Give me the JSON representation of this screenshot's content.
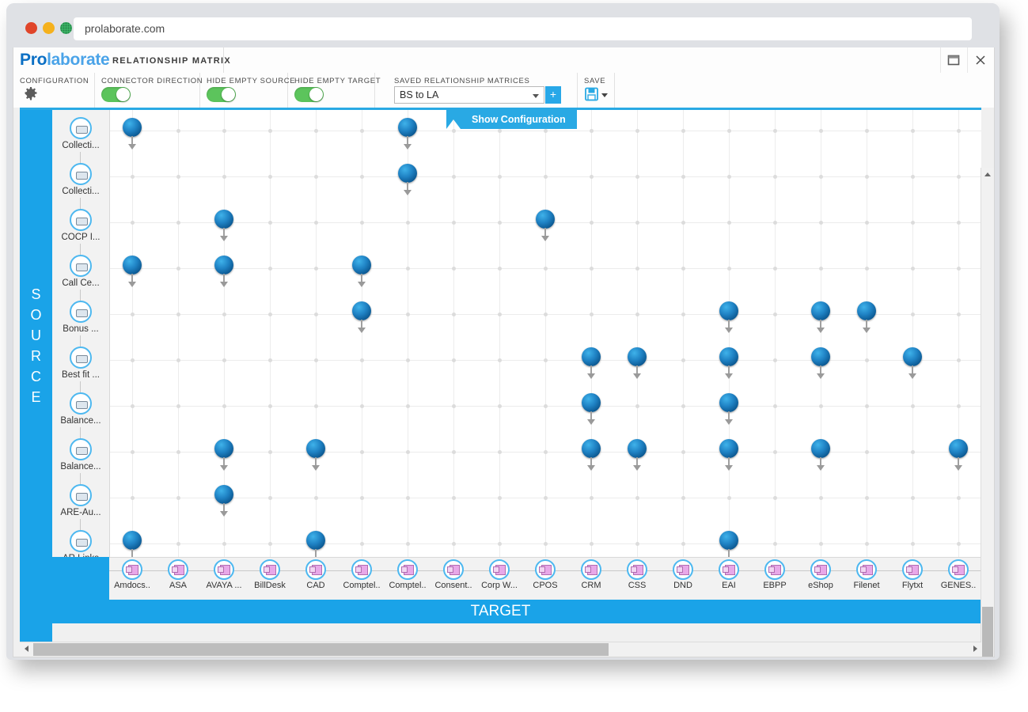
{
  "browser": {
    "url": "prolaborate.com",
    "traffic_lights": [
      "close",
      "minimize",
      "maximize"
    ]
  },
  "app": {
    "brand_pro": "Pro",
    "brand_laborate": "laborate",
    "subtitle": "RELATIONSHIP MATRIX",
    "window_buttons": {
      "restore": "restore-icon",
      "close": "close-icon"
    }
  },
  "toolbar": {
    "configuration_label": "CONFIGURATION",
    "configuration_icon": "gear-icon",
    "connector_direction_label": "CONNECTOR DIRECTION",
    "connector_direction_on": true,
    "hide_empty_source_label": "HIDE EMPTY SOURCE",
    "hide_empty_source_on": true,
    "hide_empty_target_label": "HIDE EMPTY TARGET",
    "hide_empty_target_on": true,
    "saved_matrices_label": "SAVED RELATIONSHIP MATRICES",
    "saved_matrices_value": "BS to LA",
    "add_button_label": "+",
    "save_label": "SAVE",
    "save_icon": "floppy-disk-icon"
  },
  "matrix": {
    "show_configuration_label": "Show Configuration",
    "source_axis_label": "SOURCE",
    "target_axis_label": "TARGET",
    "accent_color": "#1aa3e8",
    "marker_color": "#1f82c4",
    "toggle_color": "#5cc45c"
  },
  "chart_data": {
    "type": "heatmap",
    "title": "Relationship Matrix — BS to LA",
    "xlabel": "TARGET",
    "ylabel": "SOURCE",
    "grid": true,
    "legend": "none",
    "categories": [
      "Amdocs..",
      "ASA",
      "AVAYA ...",
      "BillDesk",
      "CAD",
      "Comptel..",
      "Comptel..",
      "Consent..",
      "Corp W...",
      "CPOS",
      "CRM",
      "CSS",
      "DND",
      "EAI",
      "EBPP",
      "eShop",
      "Filenet",
      "Flytxt",
      "GENES.."
    ],
    "rows": [
      "Collecti...",
      "Collecti...",
      "COCP I...",
      "Call Ce...",
      "Bonus ...",
      "Best fit ...",
      "Balance...",
      "Balance...",
      "ARE-Au...",
      "AR Links"
    ],
    "cells": [
      {
        "row": 0,
        "col": 0
      },
      {
        "row": 0,
        "col": 6
      },
      {
        "row": 1,
        "col": 6
      },
      {
        "row": 2,
        "col": 2
      },
      {
        "row": 2,
        "col": 9
      },
      {
        "row": 3,
        "col": 0
      },
      {
        "row": 3,
        "col": 2
      },
      {
        "row": 3,
        "col": 5
      },
      {
        "row": 4,
        "col": 5
      },
      {
        "row": 4,
        "col": 13
      },
      {
        "row": 4,
        "col": 15
      },
      {
        "row": 4,
        "col": 16
      },
      {
        "row": 5,
        "col": 10
      },
      {
        "row": 5,
        "col": 11
      },
      {
        "row": 5,
        "col": 13
      },
      {
        "row": 5,
        "col": 15
      },
      {
        "row": 5,
        "col": 17
      },
      {
        "row": 6,
        "col": 10
      },
      {
        "row": 6,
        "col": 13
      },
      {
        "row": 7,
        "col": 2
      },
      {
        "row": 7,
        "col": 4
      },
      {
        "row": 7,
        "col": 10
      },
      {
        "row": 7,
        "col": 11
      },
      {
        "row": 7,
        "col": 13
      },
      {
        "row": 7,
        "col": 15
      },
      {
        "row": 7,
        "col": 18
      },
      {
        "row": 8,
        "col": 2
      },
      {
        "row": 9,
        "col": 0
      },
      {
        "row": 9,
        "col": 4
      },
      {
        "row": 9,
        "col": 13
      }
    ],
    "cell_value": 1,
    "empty_value": 0
  }
}
